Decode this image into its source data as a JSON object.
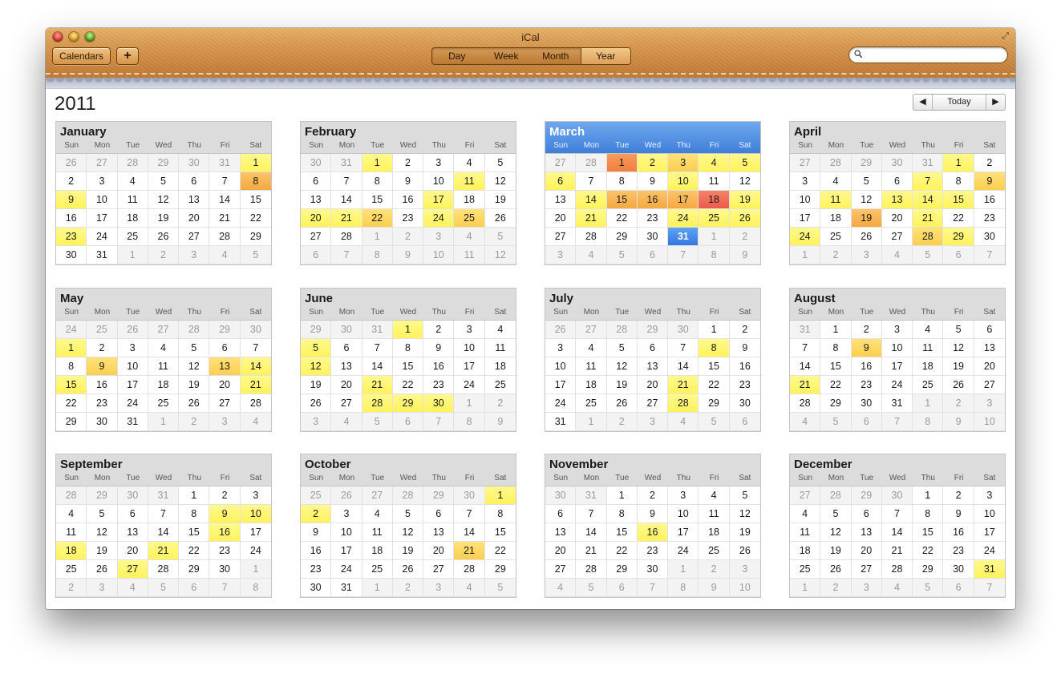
{
  "window": {
    "title": "iCal",
    "toolbar": {
      "calendars_label": "Calendars",
      "add_label": "+"
    },
    "views": [
      {
        "label": "Day",
        "active": false
      },
      {
        "label": "Week",
        "active": false
      },
      {
        "label": "Month",
        "active": false
      },
      {
        "label": "Year",
        "active": true
      }
    ],
    "search": {
      "value": "",
      "placeholder": ""
    }
  },
  "calendar": {
    "year": "2011",
    "nav": {
      "prev": "◀",
      "today": "Today",
      "next": "▶"
    },
    "weekdays": [
      "Sun",
      "Mon",
      "Tue",
      "Wed",
      "Thu",
      "Fri",
      "Sat"
    ],
    "selected_month": 2,
    "today": {
      "month": 2,
      "day": 31
    },
    "months": [
      {
        "name": "January",
        "year": 2011,
        "month": 0,
        "heat": {
          "1": 1,
          "8": 3,
          "9": 1,
          "23": 1
        }
      },
      {
        "name": "February",
        "year": 2011,
        "month": 1,
        "heat": {
          "1": 1,
          "11": 1,
          "17": 1,
          "20": 1,
          "21": 1,
          "22": 2,
          "24": 1,
          "25": 2
        }
      },
      {
        "name": "March",
        "year": 2011,
        "month": 2,
        "heat": {
          "1": 4,
          "2": 1,
          "3": 2,
          "4": 1,
          "5": 1,
          "6": 1,
          "10": 1,
          "14": 1,
          "15": 3,
          "16": 3,
          "17": 3,
          "18": 5,
          "19": 1,
          "21": 1,
          "24": 1,
          "25": 1,
          "26": 1
        }
      },
      {
        "name": "April",
        "year": 2011,
        "month": 3,
        "heat": {
          "1": 1,
          "7": 1,
          "9": 2,
          "11": 1,
          "13": 1,
          "14": 1,
          "15": 1,
          "19": 3,
          "21": 1,
          "24": 1,
          "28": 2,
          "29": 1
        }
      },
      {
        "name": "May",
        "year": 2011,
        "month": 4,
        "heat": {
          "1": 1,
          "9": 2,
          "13": 2,
          "14": 1,
          "15": 1,
          "21": 1
        }
      },
      {
        "name": "June",
        "year": 2011,
        "month": 5,
        "heat": {
          "1": 1,
          "5": 1,
          "12": 1,
          "21": 1,
          "28": 1,
          "29": 1,
          "30": 1
        }
      },
      {
        "name": "July",
        "year": 2011,
        "month": 6,
        "heat": {
          "8": 1,
          "21": 1,
          "28": 1
        }
      },
      {
        "name": "August",
        "year": 2011,
        "month": 7,
        "heat": {
          "9": 2,
          "21": 1
        }
      },
      {
        "name": "September",
        "year": 2011,
        "month": 8,
        "heat": {
          "9": 1,
          "10": 1,
          "16": 1,
          "18": 1,
          "21": 1,
          "27": 1
        }
      },
      {
        "name": "October",
        "year": 2011,
        "month": 9,
        "heat": {
          "1": 1,
          "2": 1,
          "21": 2
        }
      },
      {
        "name": "November",
        "year": 2011,
        "month": 10,
        "heat": {
          "16": 1
        }
      },
      {
        "name": "December",
        "year": 2011,
        "month": 11,
        "heat": {
          "31": 1
        }
      }
    ]
  }
}
